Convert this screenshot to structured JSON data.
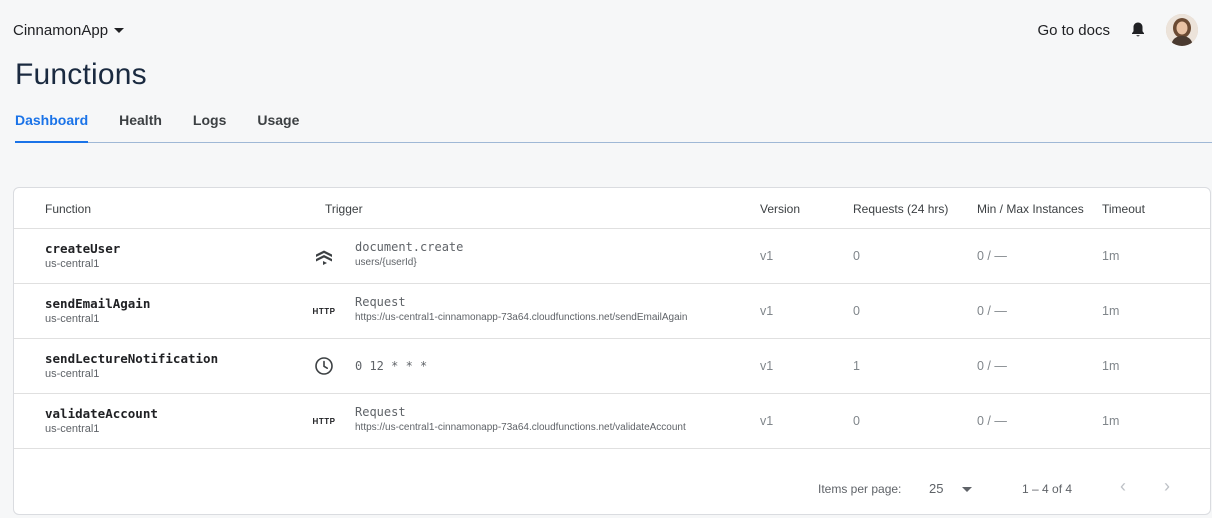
{
  "header": {
    "app_name": "CinnamonApp",
    "docs_label": "Go to docs",
    "page_title": "Functions"
  },
  "tabs": [
    {
      "label": "Dashboard",
      "active": true
    },
    {
      "label": "Health",
      "active": false
    },
    {
      "label": "Logs",
      "active": false
    },
    {
      "label": "Usage",
      "active": false
    }
  ],
  "table": {
    "columns": {
      "function": "Function",
      "trigger": "Trigger",
      "version": "Version",
      "requests": "Requests (24 hrs)",
      "instances": "Min / Max Instances",
      "timeout": "Timeout"
    },
    "rows": [
      {
        "name": "createUser",
        "region": "us-central1",
        "trigger_icon": "firestore-icon",
        "trigger_main": "document.create",
        "trigger_sub": "users/{userId}",
        "version": "v1",
        "requests": "0",
        "instances": "0 / —",
        "timeout": "1m"
      },
      {
        "name": "sendEmailAgain",
        "region": "us-central1",
        "trigger_icon": "http-icon",
        "trigger_badge": "HTTP",
        "trigger_main": "Request",
        "trigger_sub": "https://us-central1-cinnamonapp-73a64.cloudfunctions.net/sendEmailAgain",
        "version": "v1",
        "requests": "0",
        "instances": "0 / —",
        "timeout": "1m"
      },
      {
        "name": "sendLectureNotification",
        "region": "us-central1",
        "trigger_icon": "clock-icon",
        "trigger_main": "0 12 * * *",
        "version": "v1",
        "requests": "1",
        "instances": "0 / —",
        "timeout": "1m"
      },
      {
        "name": "validateAccount",
        "region": "us-central1",
        "trigger_icon": "http-icon",
        "trigger_badge": "HTTP",
        "trigger_main": "Request",
        "trigger_sub": "https://us-central1-cinnamonapp-73a64.cloudfunctions.net/validateAccount",
        "version": "v1",
        "requests": "0",
        "instances": "0 / —",
        "timeout": "1m"
      }
    ]
  },
  "pagination": {
    "items_per_page_label": "Items per page:",
    "items_per_page": "25",
    "range": "1 – 4 of 4",
    "prev_icon": "chevron-left-icon",
    "next_icon": "chevron-right-icon"
  },
  "colors": {
    "accent": "#1a73e8",
    "title": "#1a2a40",
    "background": "#f6f7f8"
  }
}
